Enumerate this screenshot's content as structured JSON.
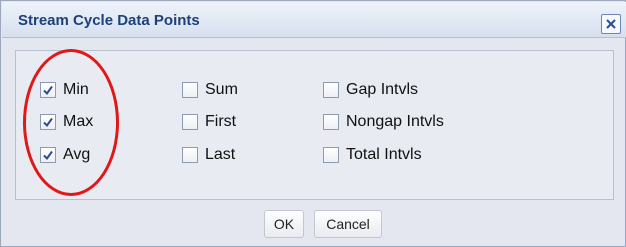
{
  "dialog": {
    "title": "Stream Cycle Data Points",
    "close_icon": "close-icon",
    "options": [
      {
        "label": "Min",
        "checked": true
      },
      {
        "label": "Max",
        "checked": true
      },
      {
        "label": "Avg",
        "checked": true
      },
      {
        "label": "Sum",
        "checked": false
      },
      {
        "label": "First",
        "checked": false
      },
      {
        "label": "Last",
        "checked": false
      },
      {
        "label": "Gap Intvls",
        "checked": false
      },
      {
        "label": "Nongap Intvls",
        "checked": false
      },
      {
        "label": "Total Intvls",
        "checked": false
      }
    ],
    "ok_label": "OK",
    "cancel_label": "Cancel"
  },
  "colors": {
    "title_text": "#1f3f7a",
    "annotation_circle": "#e01818",
    "checkmark": "#2a4d8f"
  }
}
